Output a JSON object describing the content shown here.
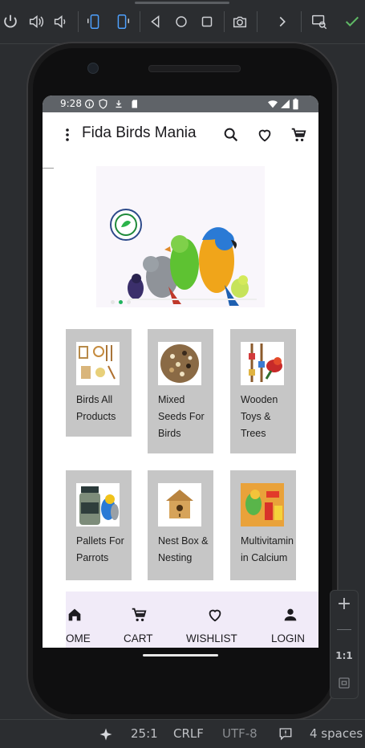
{
  "statusbar": {
    "time": "9:28"
  },
  "appbar": {
    "title": "Fida Birds Mania"
  },
  "categories": [
    {
      "label": "Birds All Products"
    },
    {
      "label": "Mixed Seeds For Birds"
    },
    {
      "label": "Wooden Toys & Trees"
    },
    {
      "label": "Pallets For Parrots"
    },
    {
      "label": "Nest Box & Nesting"
    },
    {
      "label": "Multivitamin in Calcium"
    }
  ],
  "bottom_nav": [
    {
      "label": "OME",
      "icon": "home-icon"
    },
    {
      "label": "CART",
      "icon": "cart-icon"
    },
    {
      "label": "WISHLIST",
      "icon": "heart-icon"
    },
    {
      "label": "LOGIN",
      "icon": "person-icon"
    }
  ],
  "ide_status": {
    "position": "25:1",
    "line_ending": "CRLF",
    "encoding": "UTF-8",
    "indent": "4 spaces"
  },
  "zoom": {
    "ratio": "1:1"
  }
}
